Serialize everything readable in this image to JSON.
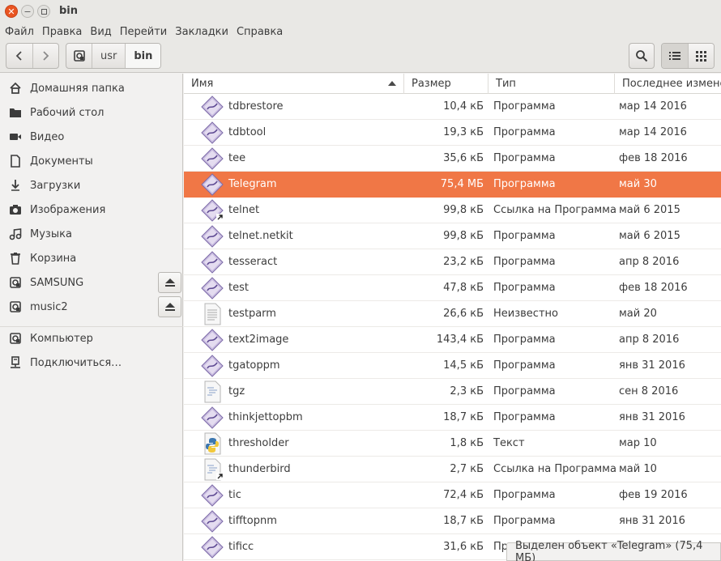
{
  "window": {
    "title": "bin"
  },
  "menu": [
    "Файл",
    "Правка",
    "Вид",
    "Перейти",
    "Закладки",
    "Справка"
  ],
  "toolbar": {
    "breadcrumb": [
      "usr",
      "bin"
    ],
    "search_icon": "search-icon",
    "view_icons": [
      "list-view-icon",
      "grid-view-icon"
    ]
  },
  "sidebar": {
    "items": [
      {
        "label": "Домашняя папка",
        "icon": "home-icon"
      },
      {
        "label": "Рабочий стол",
        "icon": "desktop-folder-icon"
      },
      {
        "label": "Видео",
        "icon": "video-icon"
      },
      {
        "label": "Документы",
        "icon": "document-icon"
      },
      {
        "label": "Загрузки",
        "icon": "download-icon"
      },
      {
        "label": "Изображения",
        "icon": "camera-icon"
      },
      {
        "label": "Музыка",
        "icon": "music-icon"
      },
      {
        "label": "Корзина",
        "icon": "trash-icon"
      },
      {
        "label": "SAMSUNG",
        "icon": "drive-icon",
        "eject": true
      },
      {
        "label": "music2",
        "icon": "drive-icon",
        "eject": true
      }
    ],
    "devices": [
      {
        "label": "Компьютер",
        "icon": "computer-icon"
      },
      {
        "label": "Подключиться…",
        "icon": "network-server-icon"
      }
    ]
  },
  "columns": {
    "name": "Имя",
    "size": "Размер",
    "type": "Тип",
    "modified": "Последнее изменен"
  },
  "files": [
    {
      "name": "tdbrestore",
      "size": "10,4 кБ",
      "type": "Программа",
      "date": "мар 14 2016",
      "icon": "program",
      "link": false,
      "selected": false
    },
    {
      "name": "tdbtool",
      "size": "19,3 кБ",
      "type": "Программа",
      "date": "мар 14 2016",
      "icon": "program",
      "link": false,
      "selected": false
    },
    {
      "name": "tee",
      "size": "35,6 кБ",
      "type": "Программа",
      "date": "фев 18 2016",
      "icon": "program",
      "link": false,
      "selected": false
    },
    {
      "name": "Telegram",
      "size": "75,4 МБ",
      "type": "Программа",
      "date": "май 30",
      "icon": "program",
      "link": false,
      "selected": true
    },
    {
      "name": "telnet",
      "size": "99,8 кБ",
      "type": "Ссылка на Программа",
      "date": "май 6 2015",
      "icon": "program",
      "link": true,
      "selected": false
    },
    {
      "name": "telnet.netkit",
      "size": "99,8 кБ",
      "type": "Программа",
      "date": "май 6 2015",
      "icon": "program",
      "link": false,
      "selected": false
    },
    {
      "name": "tesseract",
      "size": "23,2 кБ",
      "type": "Программа",
      "date": "апр 8 2016",
      "icon": "program",
      "link": false,
      "selected": false
    },
    {
      "name": "test",
      "size": "47,8 кБ",
      "type": "Программа",
      "date": "фев 18 2016",
      "icon": "program",
      "link": false,
      "selected": false
    },
    {
      "name": "testparm",
      "size": "26,6 кБ",
      "type": "Неизвестно",
      "date": "май 20",
      "icon": "text",
      "link": false,
      "selected": false
    },
    {
      "name": "text2image",
      "size": "143,4 кБ",
      "type": "Программа",
      "date": "апр 8 2016",
      "icon": "program",
      "link": false,
      "selected": false
    },
    {
      "name": "tgatoppm",
      "size": "14,5 кБ",
      "type": "Программа",
      "date": "янв 31 2016",
      "icon": "program",
      "link": false,
      "selected": false
    },
    {
      "name": "tgz",
      "size": "2,3 кБ",
      "type": "Программа",
      "date": "сен 8 2016",
      "icon": "script",
      "link": false,
      "selected": false
    },
    {
      "name": "thinkjettopbm",
      "size": "18,7 кБ",
      "type": "Программа",
      "date": "янв 31 2016",
      "icon": "program",
      "link": false,
      "selected": false
    },
    {
      "name": "thresholder",
      "size": "1,8 кБ",
      "type": "Текст",
      "date": "мар 10",
      "icon": "python",
      "link": false,
      "selected": false
    },
    {
      "name": "thunderbird",
      "size": "2,7 кБ",
      "type": "Ссылка на Программа",
      "date": "май 10",
      "icon": "script",
      "link": true,
      "selected": false
    },
    {
      "name": "tic",
      "size": "72,4 кБ",
      "type": "Программа",
      "date": "фев 19 2016",
      "icon": "program",
      "link": false,
      "selected": false
    },
    {
      "name": "tifftopnm",
      "size": "18,7 кБ",
      "type": "Программа",
      "date": "янв 31 2016",
      "icon": "program",
      "link": false,
      "selected": false
    },
    {
      "name": "tificc",
      "size": "31,6 кБ",
      "type": "Программа",
      "date": "",
      "icon": "program",
      "link": false,
      "selected": false
    }
  ],
  "status": "Выделен объект «Telegram» (75,4 МБ)",
  "colors": {
    "accent": "#f07746",
    "close": "#e95420"
  }
}
